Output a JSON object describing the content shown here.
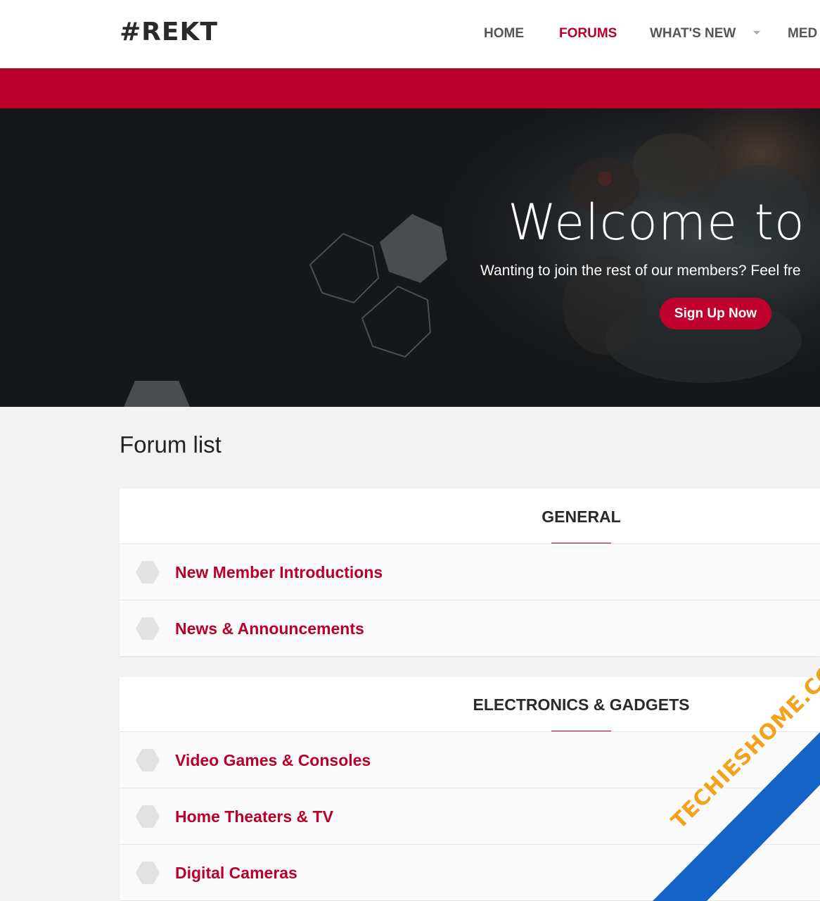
{
  "header": {
    "logo": "#REKT",
    "nav": [
      {
        "label": "HOME",
        "active": false
      },
      {
        "label": "FORUMS",
        "active": true
      },
      {
        "label": "WHAT'S NEW",
        "active": false,
        "has_dropdown": true
      },
      {
        "label": "MED",
        "active": false
      }
    ]
  },
  "hero": {
    "title": "Welcome to #R",
    "subtitle": "Wanting to join the rest of our members? Feel fre",
    "cta_label": "Sign Up Now"
  },
  "main": {
    "title": "Forum list",
    "sections": [
      {
        "title": "GENERAL",
        "nodes": [
          "New Member Introductions",
          "News & Announcements"
        ]
      },
      {
        "title": "ELECTRONICS & GADGETS",
        "nodes": [
          "Video Games & Consoles",
          "Home Theaters & TV",
          "Digital Cameras"
        ]
      }
    ]
  },
  "watermark": {
    "text": "TECHIESHOME.COM"
  },
  "colors": {
    "accent": "#b8002a",
    "header_bg": "#ffffff",
    "hero_bg": "#161719",
    "page_bg": "#f2f2f2",
    "watermark_bg": "#1464c8",
    "watermark_text": "#f2a21b"
  }
}
